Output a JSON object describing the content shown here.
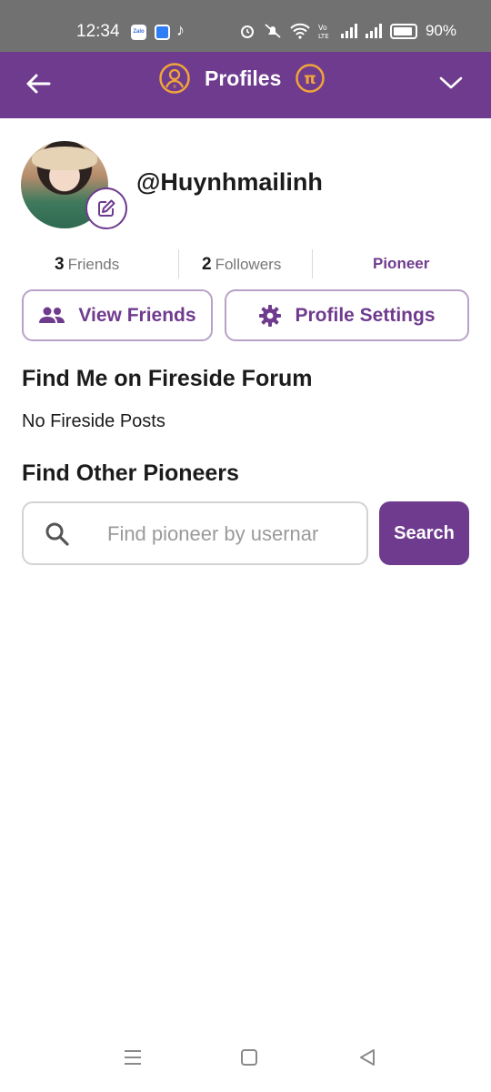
{
  "status_bar": {
    "time": "12:34",
    "zalo_label": "Zalo",
    "battery": "90%",
    "battery_level": 0.9,
    "icons": [
      "zalo-icon",
      "blue-app-icon",
      "tiktok-icon",
      "alarm-icon",
      "mute-icon",
      "wifi-icon",
      "volte-icon",
      "signal-icon",
      "signal-icon",
      "battery-icon"
    ]
  },
  "header": {
    "title": "Profiles",
    "back_icon": "arrow-left-icon",
    "dropdown_icon": "chevron-down-icon",
    "pi_logo": "π",
    "background": "#6f3b8e",
    "accent": "#f0a53b"
  },
  "profile": {
    "username": "@Huynhmailinh"
  },
  "stats": {
    "friends_count": "3",
    "friends_label": "Friends",
    "followers_count": "2",
    "followers_label": "Followers",
    "role": "Pioneer"
  },
  "actions": {
    "view_friends_label": "View Friends",
    "profile_settings_label": "Profile Settings"
  },
  "fireside": {
    "heading": "Find Me on Fireside Forum",
    "empty_text": "No Fireside Posts"
  },
  "pioneers": {
    "heading": "Find Other Pioneers",
    "search_placeholder": "Find pioneer by usernar",
    "search_value": "",
    "search_button_label": "Search"
  },
  "nav_bar": {
    "icons": [
      "menu-icon",
      "home-icon",
      "back-triangle-icon"
    ]
  }
}
